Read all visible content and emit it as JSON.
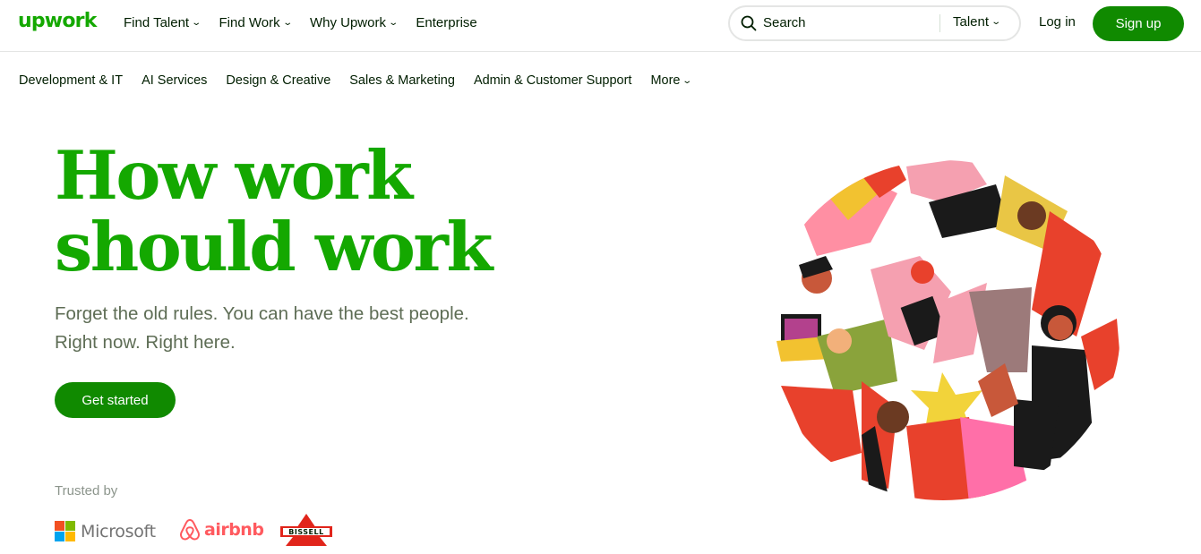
{
  "header": {
    "logo": "upwork",
    "nav": [
      {
        "label": "Find Talent"
      },
      {
        "label": "Find Work"
      },
      {
        "label": "Why Upwork"
      },
      {
        "label": "Enterprise"
      }
    ],
    "search": {
      "placeholder": "Search",
      "scope": "Talent"
    },
    "login_label": "Log in",
    "signup_label": "Sign up"
  },
  "categories": [
    {
      "label": "Development & IT"
    },
    {
      "label": "AI Services"
    },
    {
      "label": "Design & Creative"
    },
    {
      "label": "Sales & Marketing"
    },
    {
      "label": "Admin & Customer Support"
    },
    {
      "label": "More"
    }
  ],
  "hero": {
    "headline_line1": "How work",
    "headline_line2": "should work",
    "subline_line1": "Forget the old rules. You can have the best people.",
    "subline_line2": "Right now. Right here.",
    "cta_label": "Get started",
    "trusted_label": "Trusted by",
    "logos": {
      "microsoft": "Microsoft",
      "airbnb": "airbnb",
      "bissell": "BISSELL"
    }
  },
  "colors": {
    "brand_green": "#14a800",
    "button_green": "#108a00",
    "text_dark": "#001e00",
    "text_muted": "#5e6d55"
  },
  "icons": {
    "search": "search-icon",
    "dropdown": "chevron-down-icon"
  }
}
